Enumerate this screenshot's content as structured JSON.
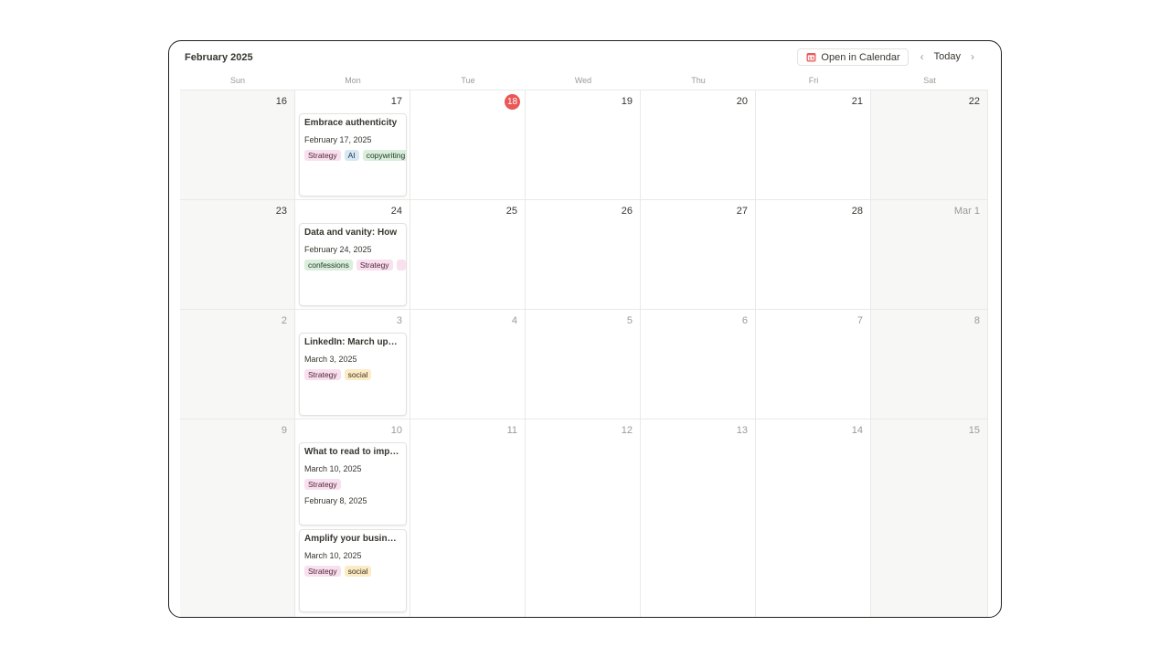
{
  "header": {
    "title": "February 2025",
    "open_in_calendar_label": "Open in Calendar",
    "prev_icon": "chevron-left-icon",
    "today_label": "Today",
    "next_icon": "chevron-right-icon",
    "calendar_icon": "calendar-icon"
  },
  "weekdays": [
    "Sun",
    "Mon",
    "Tue",
    "Wed",
    "Thu",
    "Fri",
    "Sat"
  ],
  "colors": {
    "today_circle": "#eb5757",
    "weekend_bg": "#f7f7f5",
    "tag_pink_bg": "#f9e0ee",
    "tag_pink_text": "#4c2337",
    "tag_blue_bg": "#d7e7f3",
    "tag_blue_text": "#183347",
    "tag_green_bg": "#dbeddb",
    "tag_green_text": "#1c3829",
    "tag_yellow_bg": "#fbecc6",
    "tag_yellow_text": "#402c1b"
  },
  "weeks": [
    {
      "days": [
        {
          "label": "16",
          "muted": false,
          "today": false,
          "weekend": true
        },
        {
          "label": "17",
          "muted": false,
          "today": false,
          "weekend": false
        },
        {
          "label": "18",
          "muted": false,
          "today": true,
          "weekend": false
        },
        {
          "label": "19",
          "muted": false,
          "today": false,
          "weekend": false
        },
        {
          "label": "20",
          "muted": false,
          "today": false,
          "weekend": false
        },
        {
          "label": "21",
          "muted": false,
          "today": false,
          "weekend": false
        },
        {
          "label": "22",
          "muted": false,
          "today": false,
          "weekend": true
        }
      ],
      "cards": [
        {
          "title": "Embrace authenticity",
          "dates": [
            "February 17, 2025"
          ],
          "tags": [
            {
              "label": "Strategy",
              "color": "pink"
            },
            {
              "label": "AI",
              "color": "blue"
            },
            {
              "label": "copywriting",
              "color": "green"
            }
          ]
        }
      ]
    },
    {
      "days": [
        {
          "label": "23",
          "muted": false,
          "today": false,
          "weekend": true
        },
        {
          "label": "24",
          "muted": false,
          "today": false,
          "weekend": false
        },
        {
          "label": "25",
          "muted": false,
          "today": false,
          "weekend": false
        },
        {
          "label": "26",
          "muted": false,
          "today": false,
          "weekend": false
        },
        {
          "label": "27",
          "muted": false,
          "today": false,
          "weekend": false
        },
        {
          "label": "28",
          "muted": false,
          "today": false,
          "weekend": false
        },
        {
          "label": "Mar 1",
          "muted": true,
          "today": false,
          "weekend": true
        }
      ],
      "cards": [
        {
          "title": "Data and vanity: How",
          "dates": [
            "February 24, 2025"
          ],
          "tags": [
            {
              "label": "confessions",
              "color": "green"
            },
            {
              "label": "Strategy",
              "color": "pink"
            },
            {
              "label": "",
              "color": "pink"
            }
          ]
        }
      ]
    },
    {
      "days": [
        {
          "label": "2",
          "muted": true,
          "today": false,
          "weekend": true
        },
        {
          "label": "3",
          "muted": true,
          "today": false,
          "weekend": false
        },
        {
          "label": "4",
          "muted": true,
          "today": false,
          "weekend": false
        },
        {
          "label": "5",
          "muted": true,
          "today": false,
          "weekend": false
        },
        {
          "label": "6",
          "muted": true,
          "today": false,
          "weekend": false
        },
        {
          "label": "7",
          "muted": true,
          "today": false,
          "weekend": false
        },
        {
          "label": "8",
          "muted": true,
          "today": false,
          "weekend": true
        }
      ],
      "cards": [
        {
          "title": "LinkedIn: March update",
          "dates": [
            "March 3, 2025"
          ],
          "tags": [
            {
              "label": "Strategy",
              "color": "pink"
            },
            {
              "label": "social",
              "color": "yellow"
            }
          ]
        }
      ]
    },
    {
      "days": [
        {
          "label": "9",
          "muted": true,
          "today": false,
          "weekend": true
        },
        {
          "label": "10",
          "muted": true,
          "today": false,
          "weekend": false
        },
        {
          "label": "11",
          "muted": true,
          "today": false,
          "weekend": false
        },
        {
          "label": "12",
          "muted": true,
          "today": false,
          "weekend": false
        },
        {
          "label": "13",
          "muted": true,
          "today": false,
          "weekend": false
        },
        {
          "label": "14",
          "muted": true,
          "today": false,
          "weekend": false
        },
        {
          "label": "15",
          "muted": true,
          "today": false,
          "weekend": true
        }
      ],
      "cards": [
        {
          "title": "What to read to improve",
          "dates": [
            "March 10, 2025",
            "February 8, 2025"
          ],
          "tags": [
            {
              "label": "Strategy",
              "color": "pink"
            }
          ]
        },
        {
          "title": "Amplify your business",
          "dates": [
            "March 10, 2025"
          ],
          "tags": [
            {
              "label": "Strategy",
              "color": "pink"
            },
            {
              "label": "social",
              "color": "yellow"
            }
          ]
        }
      ]
    }
  ]
}
